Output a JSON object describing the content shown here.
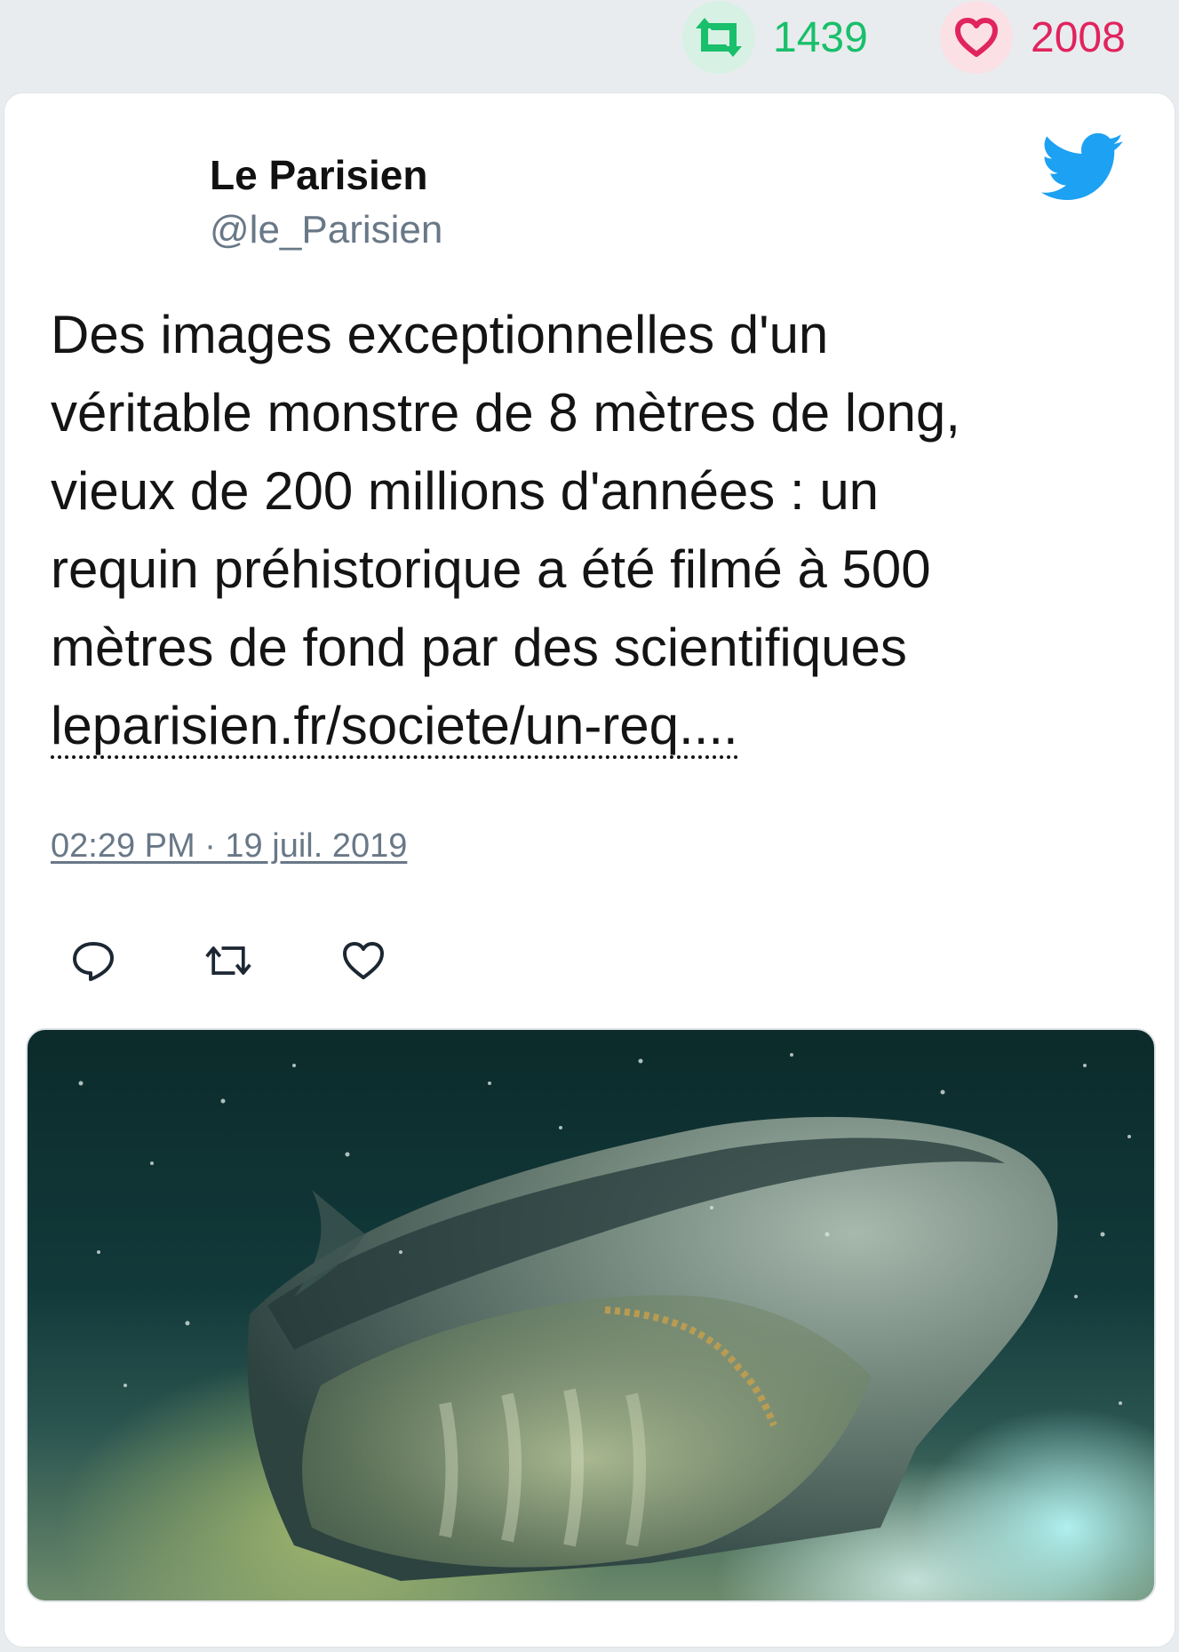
{
  "stats": {
    "retweets": "1439",
    "likes": "2008"
  },
  "author": {
    "name": "Le Parisien",
    "handle": "@le_Parisien"
  },
  "tweet": {
    "text": "Des images exceptionnelles d'un\nvéritable monstre de 8 mètres de long,\nvieux de 200 millions d'années : un\nrequin préhistorique a été filmé à 500\nmètres de fond par des scientifiques\n",
    "link": "leparisien.fr/societe/un-req...."
  },
  "timestamp": "02:29 PM · 19 juil. 2019",
  "colors": {
    "retweet": "#19bf6b",
    "like": "#e0245e",
    "twitter_blue": "#1da1f2",
    "muted": "#697887"
  },
  "icons": {
    "retweet_stat": "retweet-icon",
    "like_stat": "heart-icon",
    "brand": "twitter-bird-icon",
    "reply": "reply-icon",
    "retweet": "retweet-icon",
    "like": "heart-icon"
  },
  "media": {
    "image": "prehistoric-shark-photo"
  }
}
